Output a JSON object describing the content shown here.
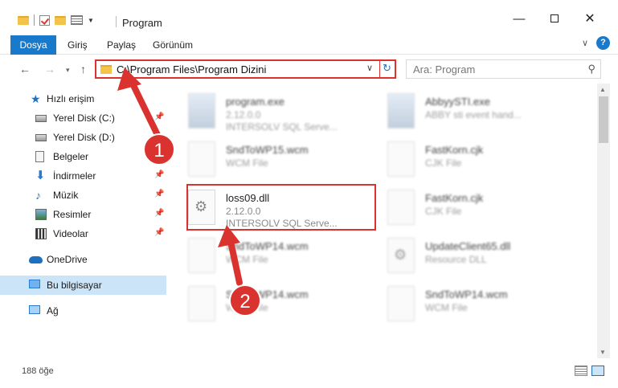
{
  "window": {
    "title": "Program",
    "minimize_glyph": "—",
    "close_glyph": "✕"
  },
  "ribbon": {
    "tabs": [
      "Dosya",
      "Giriş",
      "Paylaş",
      "Görünüm"
    ],
    "expand_glyph": "∨",
    "help_glyph": "?"
  },
  "nav": {
    "back_glyph": "←",
    "forward_glyph": "→",
    "recent_glyph": "▾",
    "up_glyph": "↑",
    "address": "C:\\Program Files\\Program Dizini",
    "address_dropdown_glyph": "∨",
    "refresh_glyph": "↻",
    "search_placeholder": "Ara: Program",
    "search_glyph": "⚲"
  },
  "sidebar": {
    "items": [
      {
        "label": "Hızlı erişim",
        "icon": "star-icon",
        "pinned": false
      },
      {
        "label": "Yerel Disk (C:)",
        "icon": "disk-icon",
        "pinned": true
      },
      {
        "label": "Yerel Disk (D:)",
        "icon": "disk-icon",
        "pinned": false
      },
      {
        "label": "Belgeler",
        "icon": "documents-icon",
        "pinned": true
      },
      {
        "label": "İndirmeler",
        "icon": "download-icon",
        "pinned": true
      },
      {
        "label": "Müzik",
        "icon": "music-icon",
        "pinned": true
      },
      {
        "label": "Resimler",
        "icon": "pictures-icon",
        "pinned": true
      },
      {
        "label": "Videolar",
        "icon": "video-icon",
        "pinned": true
      },
      {
        "label": "OneDrive",
        "icon": "onedrive-icon",
        "pinned": false
      },
      {
        "label": "Bu bilgisayar",
        "icon": "computer-icon",
        "pinned": false,
        "selected": true
      },
      {
        "label": "Ağ",
        "icon": "network-icon",
        "pinned": false
      }
    ],
    "pin_glyph": "📌",
    "star_glyph": "★",
    "download_glyph": "⬇",
    "music_glyph": "♪"
  },
  "files": [
    {
      "name": "program.exe",
      "line1": "2.12.0.0",
      "line2": "INTERSOLV SQL Serve...",
      "type": "exe"
    },
    {
      "name": "AbbyySTI.exe",
      "line1": "ABBY sti event hand...",
      "line2": "",
      "type": "exe"
    },
    {
      "name": "SndToWP15.wcm",
      "line1": "WCM File",
      "line2": "",
      "type": "doc"
    },
    {
      "name": "FastKorn.cjk",
      "line1": "CJK File",
      "line2": "",
      "type": "doc"
    },
    {
      "name": "loss09.dll",
      "line1": "2.12.0.0",
      "line2": "INTERSOLV SQL Serve...",
      "type": "dll",
      "highlighted": true
    },
    {
      "name": "FastKorn.cjk",
      "line1": "CJK File",
      "line2": "",
      "type": "doc"
    },
    {
      "name": "SndToWP14.wcm",
      "line1": "WCM File",
      "line2": "",
      "type": "doc"
    },
    {
      "name": "UpdateClient65.dll",
      "line1": "Resource DLL",
      "line2": "",
      "type": "dll"
    },
    {
      "name": "SndToWP14.wcm",
      "line1": "WCM File",
      "line2": "",
      "type": "doc"
    },
    {
      "name": "SndToWP14.wcm",
      "line1": "WCM File",
      "line2": "",
      "type": "doc"
    }
  ],
  "scrollbar": {
    "up_glyph": "▲",
    "down_glyph": "▼"
  },
  "status": {
    "item_count": "188 öğe"
  },
  "annotations": {
    "badges": [
      "1",
      "2"
    ],
    "color": "#d9322f"
  }
}
